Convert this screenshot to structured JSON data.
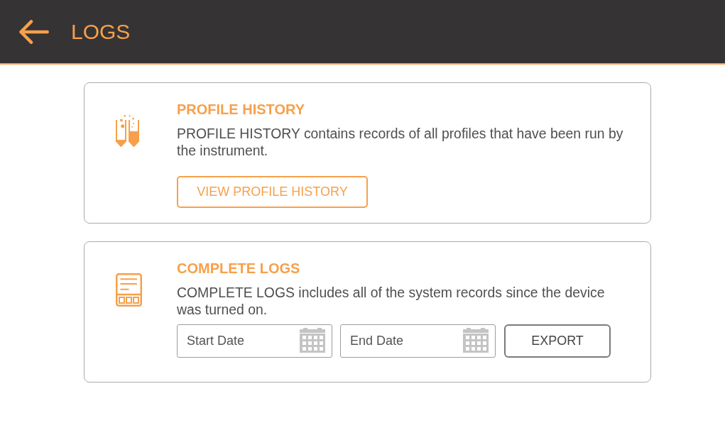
{
  "header": {
    "title": "LOGS"
  },
  "sections": [
    {
      "kind": "profile",
      "title": "PROFILE HISTORY",
      "description": "PROFILE HISTORY contains records of all profiles that have been run by the instrument.",
      "button": "VIEW PROFILE HISTORY"
    },
    {
      "kind": "logs",
      "title": "COMPLETE LOGS",
      "description": "COMPLETE LOGS includes all of the system records since the device was turned on.",
      "date_fields": [
        {
          "placeholder": "Start Date"
        },
        {
          "placeholder": "End Date"
        }
      ],
      "button": "EXPORT"
    }
  ]
}
